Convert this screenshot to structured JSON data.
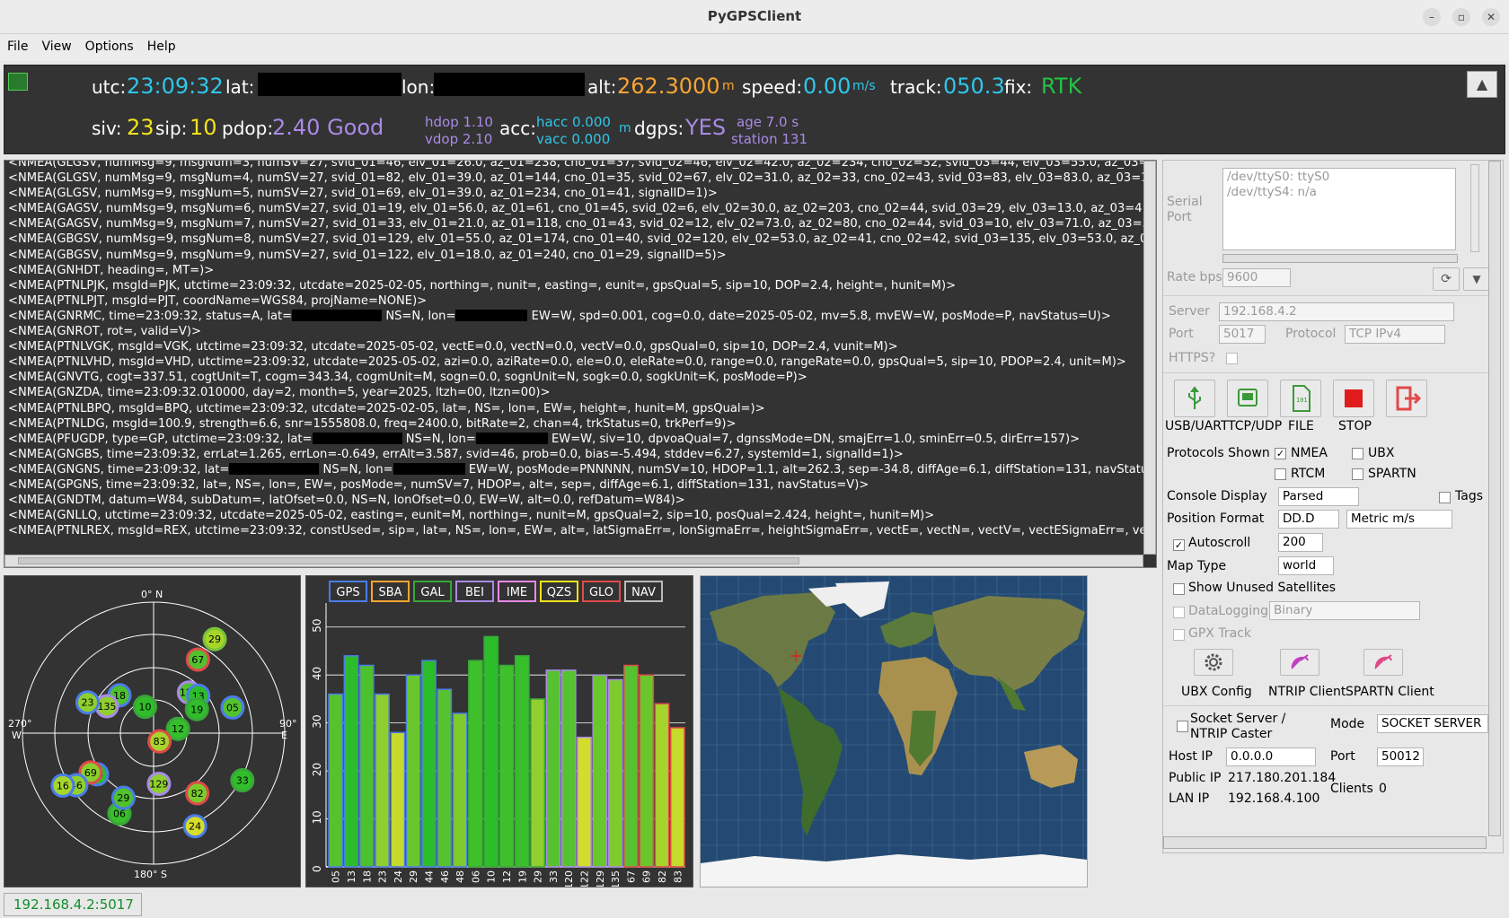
{
  "window": {
    "title": "PyGPSClient"
  },
  "menu": [
    "File",
    "View",
    "Options",
    "Help"
  ],
  "status": {
    "utc_label": "utc:",
    "utc": "23:09:32",
    "lat_label": "lat:",
    "lon_label": "lon:",
    "alt_label": "alt:",
    "alt": "262.3000",
    "alt_unit": "m",
    "speed_label": "speed:",
    "speed": "0.00",
    "speed_unit": "m/s",
    "track_label": "track:",
    "track": "050.3",
    "fix_label": "fix:",
    "fix": "RTK",
    "siv_label": "siv:",
    "siv": "23",
    "sip_label": "sip:",
    "sip": "10",
    "pdop_label": "pdop:",
    "pdop": "2.40 Good",
    "hdop": "hdop 1.10",
    "vdop": "vdop 2.10",
    "acc_label": "acc:",
    "hacc": "hacc 0.000",
    "vacc": "vacc 0.000",
    "acc_unit": "m",
    "dgps_label": "dgps:",
    "dgps": "YES",
    "age": "age 7.0 s",
    "station": "station 131"
  },
  "console_lines": [
    "<NMEA(GLGSV, numMsg=9, msgNum=3, numSV=27, svid_01=46, elv_01=26.0, az_01=238, cno_01=37, svid_02=46, elv_02=42.0, az_02=234, cno_02=32, svid_03=44, elv_03=55.0, az_03=2",
    "<NMEA(GLGSV, numMsg=9, msgNum=4, numSV=27, svid_01=82, elv_01=39.0, az_01=144, cno_01=35, svid_02=67, elv_02=31.0, az_02=33, cno_02=43, svid_03=83, elv_03=83.0, az_03=10",
    "<NMEA(GLGSV, numMsg=9, msgNum=5, numSV=27, svid_01=69, elv_01=39.0, az_01=234, cno_01=41, signalID=1)>",
    "<NMEA(GAGSV, numMsg=9, msgNum=6, numSV=27, svid_01=19, elv_01=56.0, az_01=61, cno_01=45, svid_02=6, elv_02=30.0, az_02=203, cno_02=44, svid_03=29, elv_03=13.0, az_03=41,",
    "<NMEA(GAGSV, numMsg=9, msgNum=7, numSV=27, svid_01=33, elv_01=21.0, az_01=118, cno_01=43, svid_02=12, elv_02=73.0, az_02=80, cno_02=44, svid_03=10, elv_03=71.0, az_03=34",
    "<NMEA(GBGSV, numMsg=9, msgNum=8, numSV=27, svid_01=129, elv_01=55.0, az_01=174, cno_01=40, svid_02=120, elv_02=53.0, az_02=41, cno_02=42, svid_03=135, elv_03=53.0, az_03",
    "<NMEA(GBGSV, numMsg=9, msgNum=9, numSV=27, svid_01=122, elv_01=18.0, az_01=240, cno_01=29, signalID=5)>",
    "<NMEA(GNHDT, heading=, MT=)>",
    "<NMEA(PTNLPJK, msgId=PJK, utctime=23:09:32, utcdate=2025-02-05, northing=, nunit=, easting=, eunit=, gpsQual=5, sip=10, DOP=2.4, height=, hunit=M)>",
    "<NMEA(PTNLPJT, msgId=PJT, coordName=WGS84, projName=NONE)>",
    "<NMEA(GNRMC, time=23:09:32, status=A, lat=##LAT## NS=N, lon=##LON## EW=W, spd=0.001, cog=0.0, date=2025-05-02, mv=5.8, mvEW=W, posMode=P, navStatus=U)>",
    "<NMEA(GNROT, rot=, valid=V)>",
    "<NMEA(PTNLVGK, msgId=VGK, utctime=23:09:32, utcdate=2025-05-02, vectE=0.0, vectN=0.0, vectV=0.0, gpsQual=0, sip=10, DOP=2.4, vunit=M)>",
    "<NMEA(PTNLVHD, msgId=VHD, utctime=23:09:32, utcdate=2025-05-02, azi=0.0, aziRate=0.0, ele=0.0, eleRate=0.0, range=0.0, rangeRate=0.0, gpsQual=5, sip=10, PDOP=2.4, unit=M)>",
    "<NMEA(GNVTG, cogt=337.51, cogtUnit=T, cogm=343.34, cogmUnit=M, sogn=0.0, sognUnit=N, sogk=0.0, sogkUnit=K, posMode=P)>",
    "<NMEA(GNZDA, time=23:09:32.010000, day=2, month=5, year=2025, ltzh=00, ltzn=00)>",
    "<NMEA(PTNLBPQ, msgId=BPQ, utctime=23:09:32, utcdate=2025-02-05, lat=, NS=, lon=, EW=, height=, hunit=M, gpsQual=)>",
    "<NMEA(PTNLDG, msgId=100.9, strength=6.6, snr=1555808.0, freq=2400.0, bitRate=2, chan=4, trkStatus=0, trkPerf=9)>",
    "<NMEA(PFUGDP, type=GP, utctime=23:09:32, lat=##LAT## NS=N, lon=##LON## EW=W, siv=10, dpvoaQual=7, dgnssMode=DN, smajErr=1.0, sminErr=0.5, dirErr=157)>",
    "<NMEA(GNGBS, time=23:09:32, errLat=1.265, errLon=-0.649, errAlt=3.587, svid=46, prob=0.0, bias=-5.494, stddev=6.27, systemId=1, signalId=1)>",
    "<NMEA(GNGNS, time=23:09:32, lat=##LAT## NS=N, lon=##LON## EW=W, posMode=PNNNNN, numSV=10, HDOP=1.1, alt=262.3, sep=-34.8, diffAge=6.1, diffStation=131, navStatu",
    "<NMEA(GPGNS, time=23:09:32, lat=, NS=, lon=, EW=, posMode=, numSV=7, HDOP=, alt=, sep=, diffAge=6.1, diffStation=131, navStatus=V)>",
    "<NMEA(GNDTM, datum=W84, subDatum=, latOfset=0.0, NS=N, lonOfset=0.0, EW=W, alt=0.0, refDatum=W84)>",
    "<NMEA(GNLLQ, utctime=23:09:32, utcdate=2025-05-02, easting=, eunit=M, northing=, nunit=M, gpsQual=2, sip=10, posQual=2.424, height=, hunit=M)>",
    "<NMEA(PTNLREX, msgId=REX, utctime=23:09:32, constUsed=, sip=, lat=, NS=, lon=, EW=, alt=, latSigmaErr=, lonSigmaErr=, heightSigmaErr=, vectE=, vectN=, vectV=, vectESigmaErr=, vec"
  ],
  "settings": {
    "serial_port_label": "Serial\nPort",
    "ports": [
      "/dev/ttyS0: ttyS0",
      "/dev/ttyS4: n/a"
    ],
    "rate_label": "Rate bps",
    "rate": "9600",
    "server_label": "Server",
    "server": "192.168.4.2",
    "port_label": "Port",
    "port": "5017",
    "protocol_label": "Protocol",
    "protocol": "TCP IPv4",
    "https_label": "HTTPS?",
    "btn_usb": "USB/UART",
    "btn_tcp": "TCP/UDP",
    "btn_file": "FILE",
    "btn_stop": "STOP",
    "protocols_label": "Protocols Shown",
    "nmea": "NMEA",
    "ubx": "UBX",
    "rtcm": "RTCM",
    "spartn": "SPARTN",
    "console_label": "Console Display",
    "console_value": "Parsed",
    "tags": "Tags",
    "posfmt_label": "Position Format",
    "posfmt": "DD.D",
    "units": "Metric m/s",
    "autoscroll": "Autoscroll",
    "autoscroll_lines": "200",
    "maptype_label": "Map Type",
    "maptype": "world",
    "unused_sats": "Show Unused Satellites",
    "datalogging": "DataLogging",
    "log_format": "Binary",
    "gpx": "GPX Track",
    "ubx_config": "UBX Config",
    "ntrip_client": "NTRIP Client",
    "spartn_client": "SPARTN Client",
    "socket_server": "Socket Server /\nNTRIP Caster",
    "mode_label": "Mode",
    "mode": "SOCKET SERVER",
    "hostip_label": "Host IP",
    "hostip": "0.0.0.0",
    "sport_label": "Port",
    "sport": "50012",
    "publicip_label": "Public IP",
    "publicip": "217.180.201.184",
    "lanip_label": "LAN IP",
    "lanip": "192.168.4.100",
    "clients_label": "Clients",
    "clients": "0"
  },
  "skyview": {
    "labels": {
      "north": "0° N",
      "east": "90°\nE",
      "south": "180° S",
      "west": "270°\nW"
    },
    "satellites": [
      {
        "id": "29",
        "az": 33,
        "elv": 13,
        "fill": "#a6d62a",
        "edge": "#7cc23a"
      },
      {
        "id": "67",
        "az": 31,
        "elv": 31,
        "fill": "#52c12d",
        "edge": "#e04a4a"
      },
      {
        "id": "120",
        "az": 41,
        "elv": 53,
        "fill": "#4fc22c",
        "edge": "#a98ae6"
      },
      {
        "id": "13",
        "az": 50,
        "elv": 50,
        "fill": "#2bbd2a",
        "edge": "#4a7de8"
      },
      {
        "id": "05",
        "az": 72,
        "elv": 33,
        "fill": "#53c22e",
        "edge": "#4a7de8"
      },
      {
        "id": "19",
        "az": 61,
        "elv": 56,
        "fill": "#30be2a",
        "edge": "#3aa63a"
      },
      {
        "id": "18",
        "az": 318,
        "elv": 55,
        "fill": "#4dc12c",
        "edge": "#4a7de8"
      },
      {
        "id": "10",
        "az": 342,
        "elv": 71,
        "fill": "#2fbe2a",
        "edge": "#3aa63a"
      },
      {
        "id": "135",
        "az": 300,
        "elv": 53,
        "fill": "#8fcf2e",
        "edge": "#a98ae6"
      },
      {
        "id": "23",
        "az": 295,
        "elv": 40,
        "fill": "#8fcf2e",
        "edge": "#4a7de8"
      },
      {
        "id": "12",
        "az": 80,
        "elv": 73,
        "fill": "#35bf2a",
        "edge": "#3aa63a"
      },
      {
        "id": "83",
        "az": 144,
        "elv": 83,
        "fill": "#a8d52b",
        "edge": "#e04a4a"
      },
      {
        "id": "129",
        "az": 174,
        "elv": 55,
        "fill": "#8ece2e",
        "edge": "#a98ae6"
      },
      {
        "id": "82",
        "az": 144,
        "elv": 39,
        "fill": "#7bcb2c",
        "edge": "#e04a4a"
      },
      {
        "id": "24",
        "az": 156,
        "elv": 20,
        "fill": "#d6dd2a",
        "edge": "#4a7de8"
      },
      {
        "id": "33",
        "az": 118,
        "elv": 21,
        "fill": "#31be2a",
        "edge": "#3aa63a"
      },
      {
        "id": "06",
        "az": 203,
        "elv": 30,
        "fill": "#39bf2a",
        "edge": "#3aa63a"
      },
      {
        "id": "29",
        "az": 205,
        "elv": 41,
        "fill": "#4fc22c",
        "edge": "#4a7de8"
      },
      {
        "id": "44",
        "az": 234,
        "elv": 42,
        "fill": "#2cbd2a",
        "edge": "#4a7de8"
      },
      {
        "id": "69",
        "az": 238,
        "elv": 39,
        "fill": "#88ce2c",
        "edge": "#e04a4a"
      },
      {
        "id": "46",
        "az": 236,
        "elv": 26,
        "fill": "#8fcf2e",
        "edge": "#4a7de8"
      },
      {
        "id": "16",
        "az": 240,
        "elv": 18,
        "fill": "#a6d52b",
        "edge": "#4a7de8"
      }
    ]
  },
  "constellations": [
    {
      "name": "GPS",
      "color": "#4a7de8"
    },
    {
      "name": "SBA",
      "color": "#f7a531"
    },
    {
      "name": "GAL",
      "color": "#3aa63a"
    },
    {
      "name": "BEI",
      "color": "#a98ae6"
    },
    {
      "name": "IME",
      "color": "#e88ae6"
    },
    {
      "name": "QZS",
      "color": "#f3e21a"
    },
    {
      "name": "GLO",
      "color": "#e04a4a"
    },
    {
      "name": "NAV",
      "color": "#bbbbbb"
    }
  ],
  "chart_data": {
    "type": "bar",
    "title": "",
    "xlabel": "",
    "ylabel": "",
    "ylim": [
      0,
      55
    ],
    "yticks": [
      "0",
      "10",
      "20",
      "30",
      "40",
      "50"
    ],
    "categories": [
      "05",
      "13",
      "18",
      "23",
      "24",
      "29",
      "44",
      "46",
      "48",
      "06",
      "10",
      "12",
      "19",
      "29",
      "33",
      "120",
      "122",
      "129",
      "135",
      "67",
      "69",
      "82",
      "83"
    ],
    "values": [
      36,
      44,
      42,
      36,
      28,
      40,
      43,
      37,
      32,
      43,
      48,
      42,
      44,
      35,
      41,
      41,
      27,
      40,
      39,
      42,
      40,
      34,
      29
    ],
    "edge_colors": [
      "#4a7de8",
      "#4a7de8",
      "#4a7de8",
      "#4a7de8",
      "#4a7de8",
      "#4a7de8",
      "#4a7de8",
      "#4a7de8",
      "#4a7de8",
      "#3aa63a",
      "#3aa63a",
      "#3aa63a",
      "#3aa63a",
      "#3aa63a",
      "#a98ae6",
      "#a98ae6",
      "#a98ae6",
      "#a98ae6",
      "#a98ae6",
      "#e04a4a",
      "#e04a4a",
      "#e04a4a",
      "#e04a4a"
    ],
    "fill_colors": [
      "#56c22f",
      "#2cbd2a",
      "#4dc12c",
      "#8ece2e",
      "#c7d92b",
      "#6ac62d",
      "#2cbd2a",
      "#56c22f",
      "#7dcb2d",
      "#3fc02b",
      "#2bbd2a",
      "#3fc02b",
      "#36bf2a",
      "#91cf2e",
      "#56c22f",
      "#56c22f",
      "#d4dc2a",
      "#6ac62d",
      "#7dcb2d",
      "#56c22f",
      "#6ac62d",
      "#a5d42c",
      "#c7d92b"
    ]
  },
  "footer": {
    "address": "192.168.4.2:5017"
  }
}
